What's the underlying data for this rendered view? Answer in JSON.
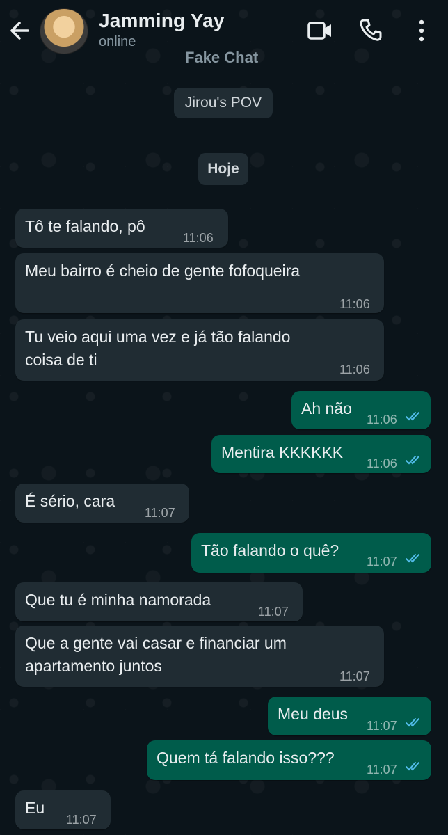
{
  "header": {
    "contact_name": "Jamming Yay",
    "status": "online",
    "chat_title": "Fake Chat"
  },
  "system": {
    "pov_label": "Jirou's POV",
    "date_label": "Hoje"
  },
  "colors": {
    "background": "#0b141a",
    "incoming_bubble": "#202c33",
    "outgoing_bubble": "#005c4b",
    "read_ticks": "#53bdeb"
  },
  "icons": [
    "back-arrow-icon",
    "video-call-icon",
    "phone-icon",
    "more-options-icon",
    "double-check-icon"
  ],
  "messages": [
    {
      "direction": "in",
      "text": "Tô te falando, pô",
      "time": "11:06"
    },
    {
      "direction": "in",
      "text": "Meu bairro é cheio de gente fofoqueira",
      "time": "11:06"
    },
    {
      "direction": "in",
      "text_line1": "Tu veio aqui uma vez e já tão falando",
      "text_line2": "coisa de ti",
      "time": "11:06"
    },
    {
      "direction": "out",
      "text": "Ah não",
      "time": "11:06",
      "read": true
    },
    {
      "direction": "out",
      "text": "Mentira KKKKKK",
      "time": "11:06",
      "read": true
    },
    {
      "direction": "in",
      "text": "É sério, cara",
      "time": "11:07"
    },
    {
      "direction": "out",
      "text": "Tão falando o quê?",
      "time": "11:07",
      "read": true
    },
    {
      "direction": "in",
      "text": "Que tu é minha namorada",
      "time": "11:07"
    },
    {
      "direction": "in",
      "text_line1": "Que a gente vai casar e financiar um",
      "text_line2": "apartamento juntos",
      "time": "11:07"
    },
    {
      "direction": "out",
      "text": "Meu deus",
      "time": "11:07",
      "read": true
    },
    {
      "direction": "out",
      "text": "Quem tá falando isso???",
      "time": "11:07",
      "read": true
    },
    {
      "direction": "in",
      "text": "Eu",
      "time": "11:07"
    }
  ]
}
